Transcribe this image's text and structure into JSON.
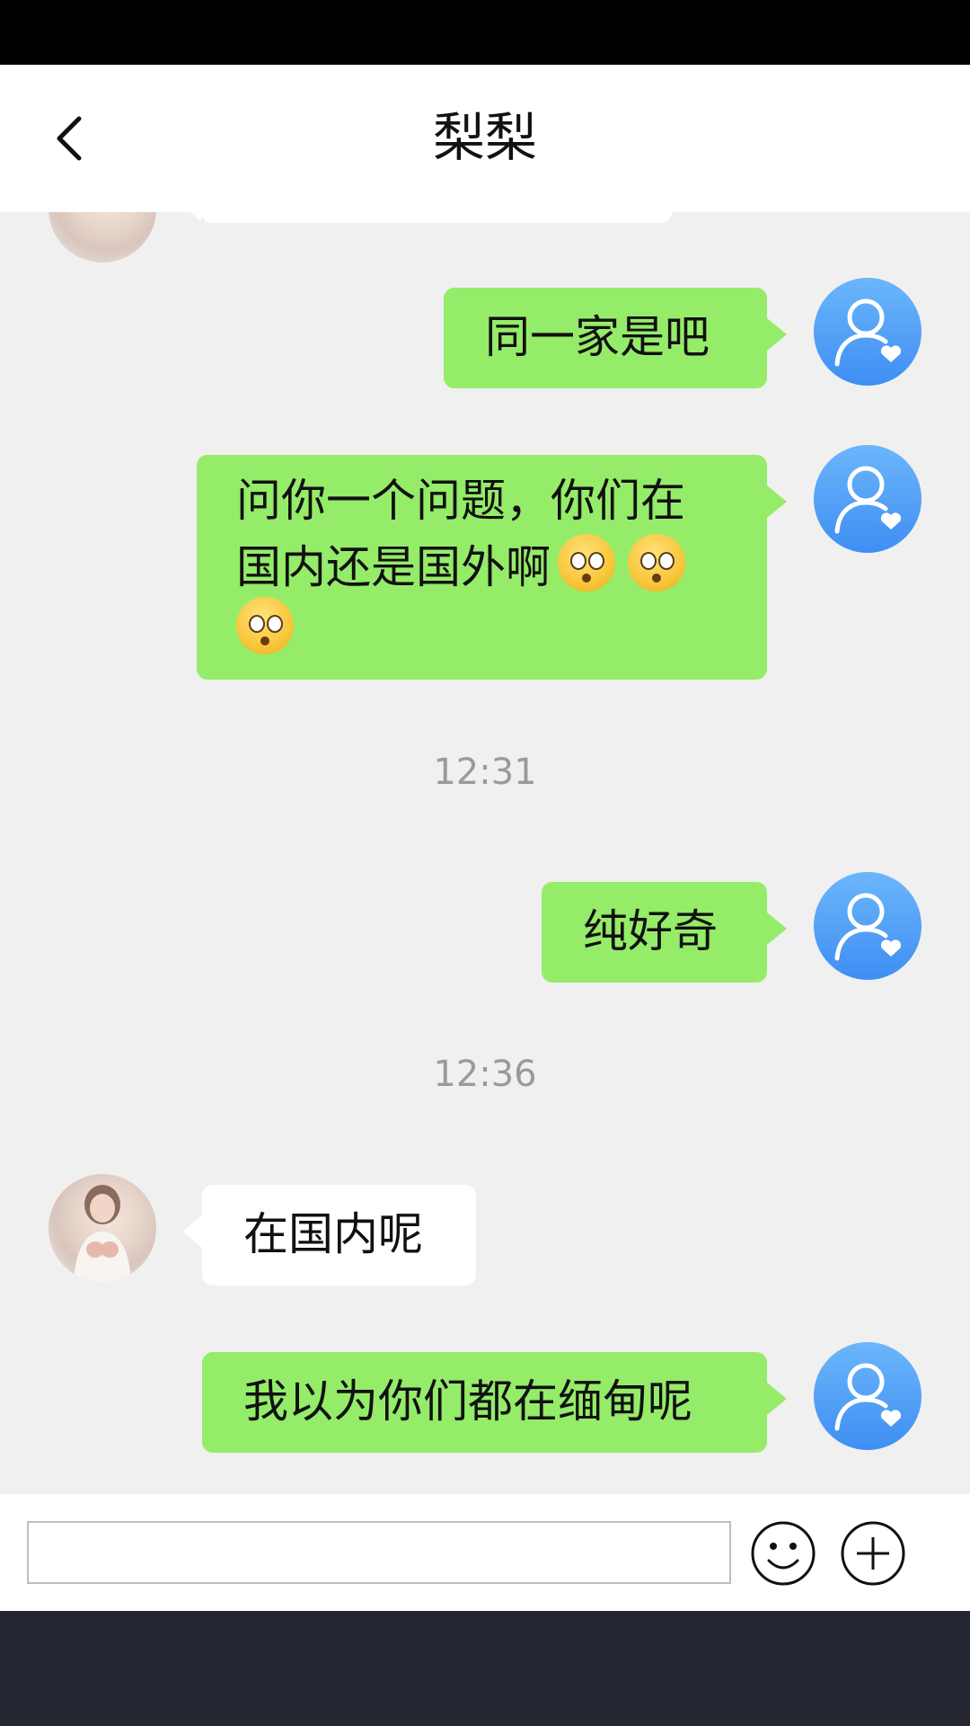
{
  "header": {
    "title": "梨梨"
  },
  "messages": [
    {
      "from": "me",
      "text": "同一家是吧"
    },
    {
      "from": "me",
      "text_line1": "问你一个问题，你们在",
      "text_line2": "国内还是国外啊",
      "emoji_count": 3
    },
    {
      "timestamp": "12:31"
    },
    {
      "from": "me",
      "text": "纯好奇"
    },
    {
      "timestamp": "12:36"
    },
    {
      "from": "other",
      "text": "在国内呢"
    },
    {
      "from": "me",
      "text": "我以为你们都在缅甸呢"
    }
  ],
  "composer": {
    "placeholder": ""
  },
  "colors": {
    "my_bubble": "#95ec69",
    "other_bubble": "#ffffff",
    "chat_bg": "#f0f0f0",
    "avatar_blue": "#4d9bf5"
  },
  "icons": {
    "back": "chevron-left-icon",
    "emoji": "smiley-icon",
    "more": "plus-circle-icon"
  }
}
